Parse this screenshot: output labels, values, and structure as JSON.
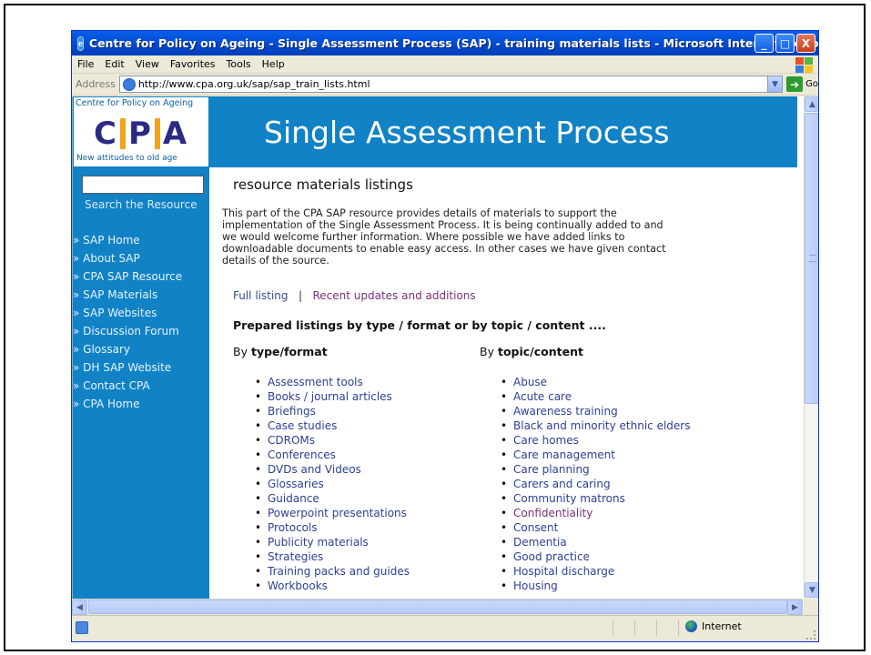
{
  "window": {
    "title": "Centre for Policy on Ageing - Single Assessment Process (SAP) - training materials lists - Microsoft Internet Explorer",
    "minimize": "_",
    "maximize": "□",
    "close": "X"
  },
  "menu": [
    "File",
    "Edit",
    "View",
    "Favorites",
    "Tools",
    "Help"
  ],
  "address": {
    "label": "Address",
    "url": "http://www.cpa.org.uk/sap/sap_train_lists.html",
    "go_label": "Go"
  },
  "sidebar": {
    "logo_top": "Centre for Policy on Ageing",
    "logo_letters": [
      "C",
      "P",
      "A"
    ],
    "logo_tagline": "New attitudes to old age",
    "search_label": "Search the Resource",
    "nav": [
      "» SAP Home",
      "» About SAP",
      "» CPA SAP Resource",
      "» SAP Materials",
      "» SAP Websites",
      "» Discussion Forum",
      "» Glossary",
      "» DH SAP Website",
      "» Contact CPA",
      "» CPA Home"
    ]
  },
  "banner": {
    "title": "Single Assessment Process"
  },
  "main": {
    "heading": "resource materials listings",
    "intro_lines": [
      "This part of the CPA SAP resource provides details of materials to support the",
      "implementation of the Single Assessment Process. It is being continually added to and",
      "we would welcome further information. Where possible we have added links to",
      "downloadable documents to enable easy access. In other cases we have given contact",
      "details of the source."
    ],
    "full_listing": "Full listing",
    "separator": "|",
    "recent_updates": "Recent updates and additions",
    "prepared": "Prepared listings by type / format or by topic / content ....",
    "col1_prefix": "By",
    "col1_title": "type/format",
    "col2_prefix": "By",
    "col2_title": "topic/content",
    "type_format": [
      "Assessment tools",
      "Books / journal articles",
      "Briefings",
      "Case studies",
      "CDROMs",
      "Conferences",
      "DVDs and Videos",
      "Glossaries",
      "Guidance",
      "Powerpoint presentations",
      "Protocols",
      "Publicity materials",
      "Strategies",
      "Training packs and guides",
      "Workbooks"
    ],
    "topic_content": [
      "Abuse",
      "Acute care",
      "Awareness training",
      "Black and minority ethnic elders",
      "Care homes",
      "Care management",
      "Care planning",
      "Carers and caring",
      "Community matrons",
      "Confidentiality",
      "Consent",
      "Dementia",
      "Good practice",
      "Hospital discharge",
      "Housing"
    ]
  },
  "status": {
    "zone": "Internet"
  },
  "colors": {
    "brand_blue": "#1082c5",
    "logo_orange": "#f2a31c",
    "link": "#2c3f98",
    "visited": "#7a2f7a"
  }
}
